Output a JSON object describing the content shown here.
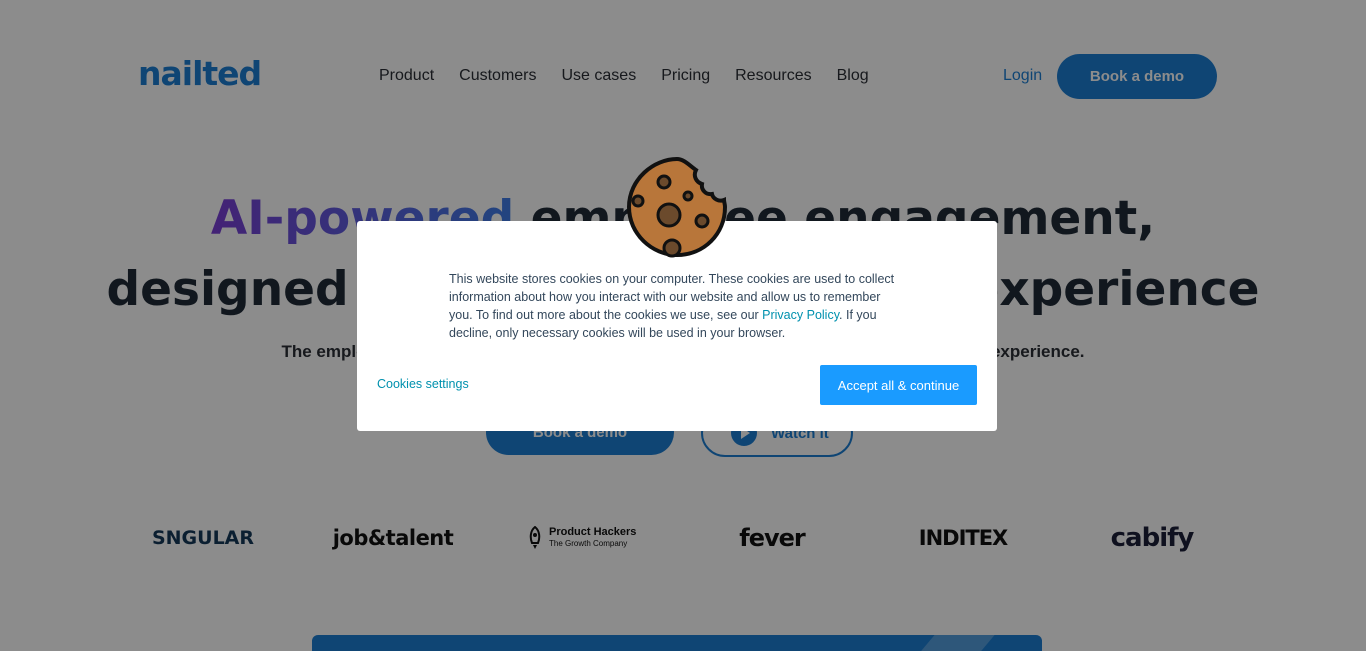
{
  "header": {
    "logo": "nailted",
    "nav": [
      "Product",
      "Customers",
      "Use cases",
      "Pricing",
      "Resources",
      "Blog"
    ],
    "login": "Login",
    "book_demo": "Book a demo"
  },
  "hero": {
    "title_accent": "AI-powered",
    "title_line1_rest": " employee engagement,",
    "title_line2": "designed for the best employee experience",
    "subtitle": "The employee experience platform that helps you measure and improve your employee experience.",
    "book_demo": "Book a demo",
    "watch": "Watch it"
  },
  "logos": {
    "sngular": "SNGULAR",
    "jobandtalent": "job&talent",
    "product_hackers_line1": "Product Hackers",
    "product_hackers_line2": "The Growth Company",
    "fever": "fever",
    "inditex": "INDITEX",
    "cabify": "cabify"
  },
  "cookie_banner": {
    "text_before_link": "This website stores cookies on your computer. These cookies are used to collect information about how you interact with our website and allow us to remember you. To find out more about the cookies we use, see our ",
    "link": "Privacy Policy",
    "text_after_link": ". If you decline, only necessary cookies will be used in your browser.",
    "settings": "Cookies settings",
    "accept": "Accept all & continue",
    "icon": "cookie-icon"
  },
  "colors": {
    "brand_blue": "#1d7fd4",
    "accept_blue": "#1a9bff",
    "link_teal": "#0091ae",
    "overlay": "rgba(0,0,0,0.45)"
  }
}
